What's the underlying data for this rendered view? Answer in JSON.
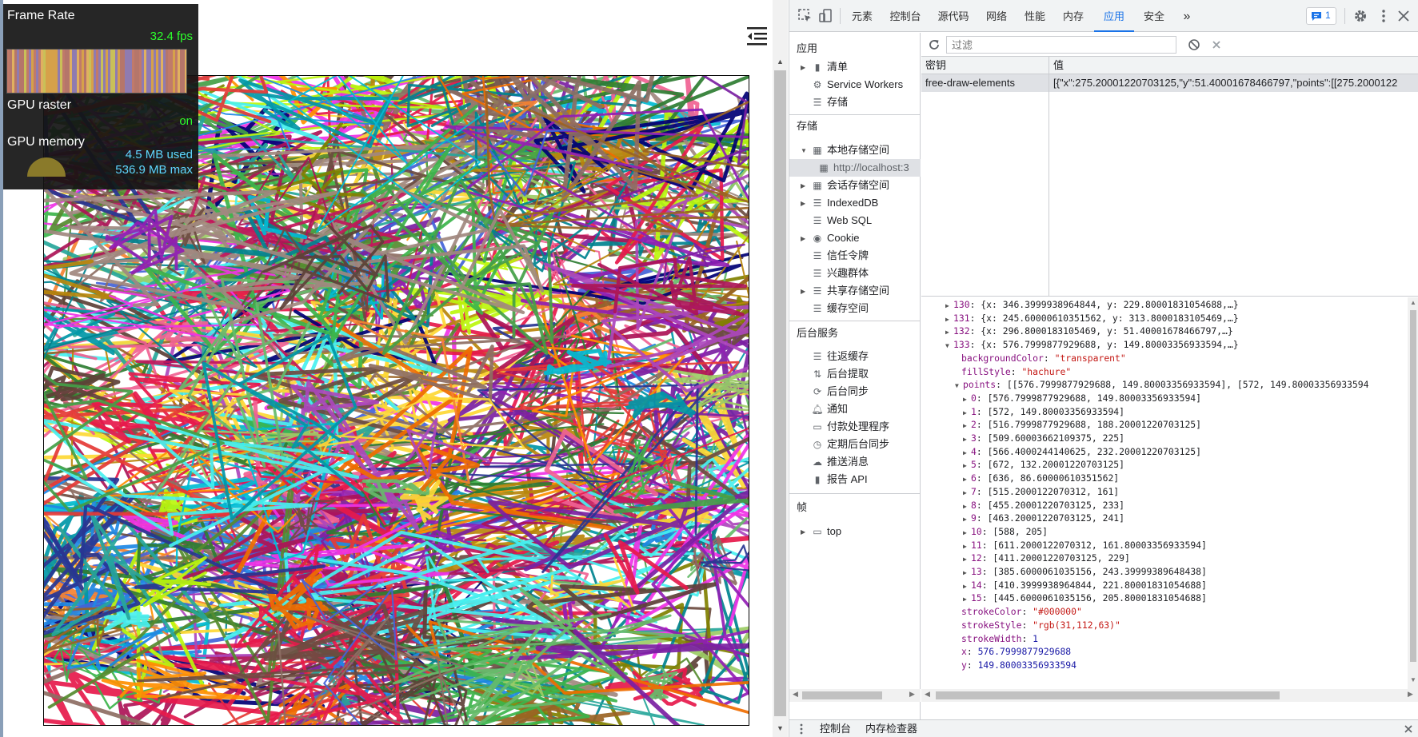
{
  "perf": {
    "frame_rate_label": "Frame Rate",
    "fps": "32.4 fps",
    "gpu_raster_label": "GPU raster",
    "gpu_raster_value": "on",
    "gpu_memory_label": "GPU memory",
    "gpu_used": "4.5 MB used",
    "gpu_max": "536.9 MB max"
  },
  "devtools": {
    "tabs": [
      "元素",
      "控制台",
      "源代码",
      "网络",
      "性能",
      "内存",
      "应用",
      "安全"
    ],
    "active_tab": "应用",
    "more": "»",
    "issues_count": "1",
    "sidebar": {
      "app_header": "应用",
      "app_items": [
        "清单",
        "Service Workers",
        "存储"
      ],
      "storage_header": "存储",
      "storage_items": [
        "本地存储空间",
        "http://localhost:3",
        "会话存储空间",
        "IndexedDB",
        "Web SQL",
        "Cookie",
        "信任令牌",
        "兴趣群体",
        "共享存储空间",
        "缓存空间"
      ],
      "bg_header": "后台服务",
      "bg_items": [
        "往返缓存",
        "后台提取",
        "后台同步",
        "通知",
        "付款处理程序",
        "定期后台同步",
        "推送消息",
        "报告 API"
      ],
      "frames_header": "帧",
      "frames_items": [
        "top"
      ]
    },
    "filter_placeholder": "过滤",
    "table": {
      "col_key": "密钥",
      "col_value": "值",
      "row_key": "free-draw-elements",
      "row_value": "[{\"x\":275.20001220703125,\"y\":51.40001678466797,\"points\":[[275.2000122"
    },
    "tree": [
      {
        "idx": "130",
        "summary": "{x: 346.3999938964844, y: 229.80001831054688,…}"
      },
      {
        "idx": "131",
        "summary": "{x: 245.60000610351562, y: 313.8000183105469,…}"
      },
      {
        "idx": "132",
        "summary": "{x: 296.8000183105469, y: 51.40001678466797,…}"
      },
      {
        "idx": "133",
        "summary": "{x: 576.7999877929688, y: 149.80003356933594,…}"
      }
    ],
    "obj": {
      "backgroundColor": "\"transparent\"",
      "fillStyle": "\"hachure\"",
      "points_summary": "[[576.7999877929688, 149.80003356933594], [572, 149.80003356933594",
      "points": [
        "[576.7999877929688, 149.80003356933594]",
        "[572, 149.80003356933594]",
        "[516.7999877929688, 188.20001220703125]",
        "[509.60003662109375, 225]",
        "[566.4000244140625, 232.20001220703125]",
        "[672, 132.20001220703125]",
        "[636, 86.60000610351562]",
        "[515.2000122070312, 161]",
        "[455.20001220703125, 233]",
        "[463.20001220703125, 241]",
        "[588, 205]",
        "[611.2000122070312, 161.80003356933594]",
        "[411.20001220703125, 229]",
        "[385.6000061035156, 243.39999389648438]",
        "[410.3999938964844, 221.80001831054688]",
        "[445.6000061035156, 205.80001831054688]"
      ],
      "strokeColor": "\"#000000\"",
      "strokeStyle": "\"rgb(31,112,63)\"",
      "strokeWidth": "1",
      "x": "576.7999877929688",
      "y": "149.80003356933594"
    },
    "drawer": {
      "console": "控制台",
      "memory_inspector": "内存检查器"
    }
  }
}
